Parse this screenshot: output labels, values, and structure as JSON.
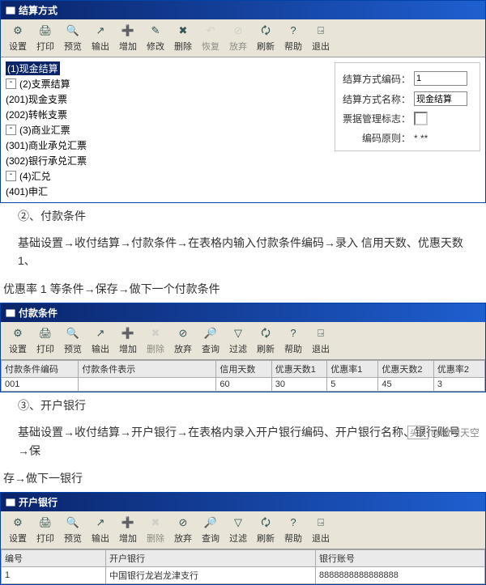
{
  "win1": {
    "title": "结算方式",
    "toolbar": [
      {
        "label": "设置",
        "icon": "gear"
      },
      {
        "label": "打印",
        "icon": "print"
      },
      {
        "label": "预览",
        "icon": "preview"
      },
      {
        "label": "输出",
        "icon": "export"
      },
      {
        "label": "增加",
        "icon": "add"
      },
      {
        "label": "修改",
        "icon": "edit"
      },
      {
        "label": "删除",
        "icon": "delete"
      },
      {
        "label": "恢复",
        "icon": "undo",
        "disabled": true
      },
      {
        "label": "放弃",
        "icon": "cancel",
        "disabled": true
      },
      {
        "label": "刷新",
        "icon": "refresh"
      },
      {
        "label": "帮助",
        "icon": "help"
      },
      {
        "label": "退出",
        "icon": "exit"
      }
    ],
    "tree": {
      "n1": "(1)现金结算",
      "n2": "(2)支票结算",
      "n2_1": "(201)现金支票",
      "n2_2": "(202)转帐支票",
      "n3": "(3)商业汇票",
      "n3_1": "(301)商业承兑汇票",
      "n3_2": "(302)银行承兑汇票",
      "n4": "(4)汇兑",
      "n4_1": "(401)申汇"
    },
    "form": {
      "code_label": "结算方式编码：",
      "code_value": "1",
      "name_label": "结算方式名称：",
      "name_value": "现金结算",
      "flag_label": "票据管理标志：",
      "rule_label": "编码原则：",
      "rule_value": "* **"
    }
  },
  "section2": {
    "heading": "②、付款条件",
    "para1": "基础设置→收付结算→付款条件→在表格内输入付款条件编码→录入 信用天数、优惠天数 1、",
    "para2": "优惠率 1 等条件→保存→做下一个付款条件"
  },
  "win2": {
    "title": "付款条件",
    "toolbar": [
      {
        "label": "设置",
        "icon": "gear"
      },
      {
        "label": "打印",
        "icon": "print"
      },
      {
        "label": "预览",
        "icon": "preview"
      },
      {
        "label": "输出",
        "icon": "export"
      },
      {
        "label": "增加",
        "icon": "add"
      },
      {
        "label": "删除",
        "icon": "delete",
        "disabled": true
      },
      {
        "label": "放弃",
        "icon": "cancel"
      },
      {
        "label": "查询",
        "icon": "search"
      },
      {
        "label": "过滤",
        "icon": "filter"
      },
      {
        "label": "刷新",
        "icon": "refresh"
      },
      {
        "label": "帮助",
        "icon": "help"
      },
      {
        "label": "退出",
        "icon": "exit"
      }
    ],
    "cols": [
      "付款条件编码",
      "付款条件表示",
      "信用天数",
      "优惠天数1",
      "优惠率1",
      "优惠天数2",
      "优惠率2"
    ],
    "row": [
      "001",
      "",
      "60",
      "30",
      "5",
      "45",
      "3"
    ]
  },
  "section3": {
    "heading": "③、开户银行",
    "para1": "基础设置→收付结算→开户银行→在表格内录入开户银行编码、开户银行名称、银行账号→保",
    "para2": "存→做下一银行"
  },
  "win3": {
    "title": "开户银行",
    "toolbar": [
      {
        "label": "设置",
        "icon": "gear"
      },
      {
        "label": "打印",
        "icon": "print"
      },
      {
        "label": "预览",
        "icon": "preview"
      },
      {
        "label": "输出",
        "icon": "export"
      },
      {
        "label": "增加",
        "icon": "add"
      },
      {
        "label": "删除",
        "icon": "delete",
        "disabled": true
      },
      {
        "label": "放弃",
        "icon": "cancel"
      },
      {
        "label": "查询",
        "icon": "search"
      },
      {
        "label": "过滤",
        "icon": "filter"
      },
      {
        "label": "刷新",
        "icon": "refresh"
      },
      {
        "label": "帮助",
        "icon": "help"
      },
      {
        "label": "退出",
        "icon": "exit"
      }
    ],
    "cols": [
      "编号",
      "开户银行",
      "银行账号"
    ],
    "row": [
      "1",
      "中国银行龙岩龙津支行",
      "8888888888888888"
    ]
  },
  "watermark": {
    "prefix": "头条",
    "author": "@嗷叫天空"
  },
  "icons": {
    "gear": "⚙",
    "print": "🖨",
    "preview": "🔍",
    "export": "↗",
    "add": "➕",
    "edit": "✎",
    "delete": "✖",
    "undo": "↶",
    "cancel": "⊘",
    "refresh": "🗘",
    "help": "?",
    "exit": "⍈",
    "search": "🔎",
    "filter": "▽"
  }
}
